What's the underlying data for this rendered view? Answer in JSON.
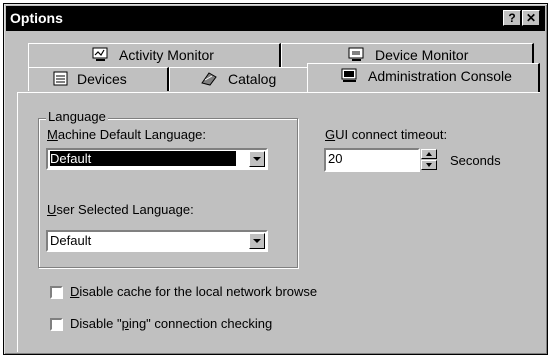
{
  "window": {
    "title": "Options",
    "help_button": "?",
    "close_button": "✕"
  },
  "tabs": {
    "back_row": [
      {
        "label": "Activity Monitor",
        "icon": "activity-monitor-icon"
      },
      {
        "label": "Device Monitor",
        "icon": "device-monitor-icon"
      }
    ],
    "front_row": [
      {
        "label": "Devices",
        "icon": "devices-icon"
      },
      {
        "label": "Catalog",
        "icon": "catalog-icon"
      },
      {
        "label": "Administration Console",
        "icon": "administration-console-icon",
        "selected": true
      }
    ]
  },
  "language_group": {
    "legend": "Language",
    "machine_default_label_key": "M",
    "machine_default_label_rest": "achine Default Language:",
    "machine_default_value": "Default",
    "user_selected_label_key": "U",
    "user_selected_label_rest": "ser Selected Language:",
    "user_selected_value": "Default"
  },
  "timeout": {
    "label_key": "G",
    "label_rest": "UI connect timeout:",
    "value": "20",
    "unit": "Seconds"
  },
  "checkboxes": [
    {
      "key": "D",
      "rest": "isable cache for the local network browse",
      "checked": false
    },
    {
      "pre": "Disable \"",
      "key": "p",
      "rest": "ing\" connection checking",
      "checked": false
    }
  ]
}
